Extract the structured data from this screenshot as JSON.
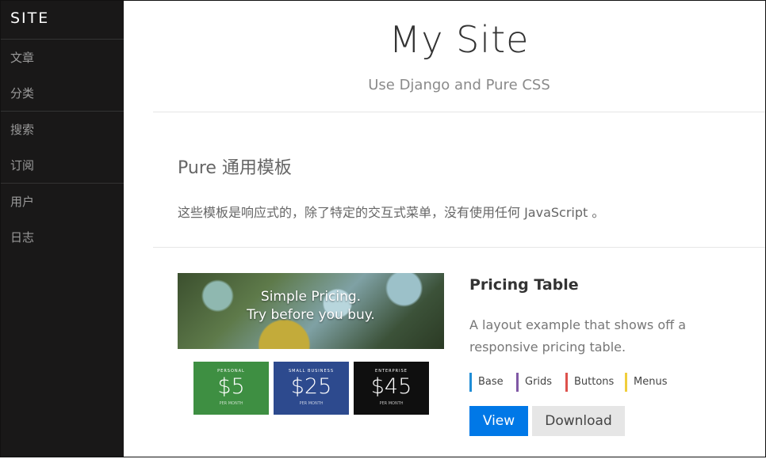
{
  "sidebar": {
    "brand": "SITE",
    "groups": [
      [
        "文章",
        "分类"
      ],
      [
        "搜索",
        "订阅"
      ],
      [
        "用户",
        "日志"
      ]
    ]
  },
  "header": {
    "title": "My Site",
    "subtitle": "Use Django and Pure CSS"
  },
  "intro": {
    "heading": "Pure 通用模板",
    "text": "这些模板是响应式的，除了特定的交互式菜单，没有使用任何 JavaScript 。"
  },
  "example": {
    "preview": {
      "hero_line1": "Simple Pricing.",
      "hero_line2": "Try before you buy.",
      "plans": [
        {
          "name": "PERSONAL",
          "price": "$5",
          "per": "PER MONTH"
        },
        {
          "name": "SMALL BUSINESS",
          "price": "$25",
          "per": "PER MONTH"
        },
        {
          "name": "ENTERPRISE",
          "price": "$45",
          "per": "PER MONTH"
        }
      ]
    },
    "title": "Pricing Table",
    "description": "A layout example that shows off a responsive pricing table.",
    "tags": [
      "Base",
      "Grids",
      "Buttons",
      "Menus"
    ],
    "view_label": "View",
    "download_label": "Download"
  },
  "colors": {
    "sidebar_bg": "#191818",
    "primary_button": "#0078e7",
    "tag_base": "#1f8dd6",
    "tag_grids": "#8058a5",
    "tag_buttons": "#dd514c",
    "tag_menus": "#f0ce3c"
  }
}
